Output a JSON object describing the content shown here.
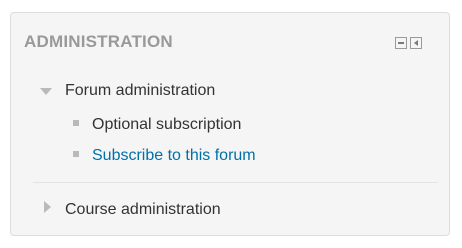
{
  "block": {
    "title": "ADMINISTRATION",
    "controls": {
      "hide_icon": "minus-box-icon",
      "dock_icon": "dock-left-icon"
    }
  },
  "tree": {
    "forum": {
      "label": "Forum administration",
      "expanded": true,
      "items": [
        {
          "label": "Optional subscription",
          "link": false
        },
        {
          "label": "Subscribe to this forum",
          "link": true
        }
      ]
    },
    "course": {
      "label": "Course administration",
      "expanded": false
    }
  },
  "colors": {
    "title": "#999999",
    "text": "#333333",
    "link": "#0070a8",
    "block_bg": "#f5f5f5",
    "border": "#dddddd"
  }
}
